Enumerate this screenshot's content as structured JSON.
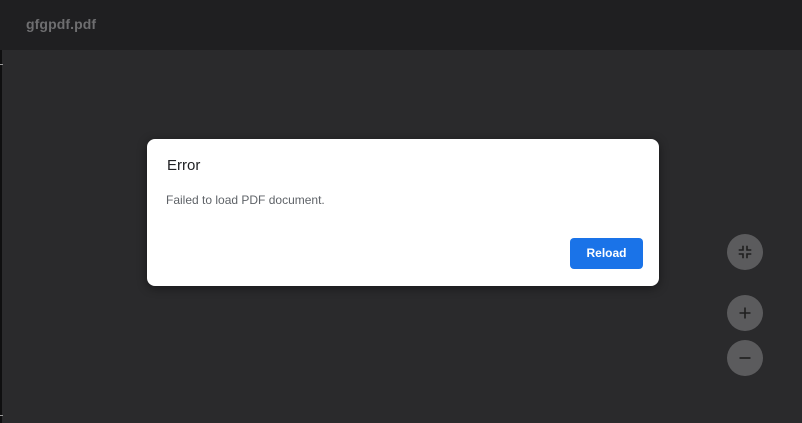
{
  "toolbar": {
    "document_title": "gfgpdf.pdf"
  },
  "error_dialog": {
    "title": "Error",
    "message": "Failed to load PDF document.",
    "reload_label": "Reload"
  },
  "zoom_controls": {
    "fit_icon": "fit-to-page-icon",
    "zoom_in_icon": "plus-icon",
    "zoom_out_icon": "minus-icon"
  },
  "colors": {
    "background": "#2a2a2c",
    "toolbar": "#1f1f21",
    "accent": "#1a73e8",
    "fab": "#5b5b5d"
  }
}
